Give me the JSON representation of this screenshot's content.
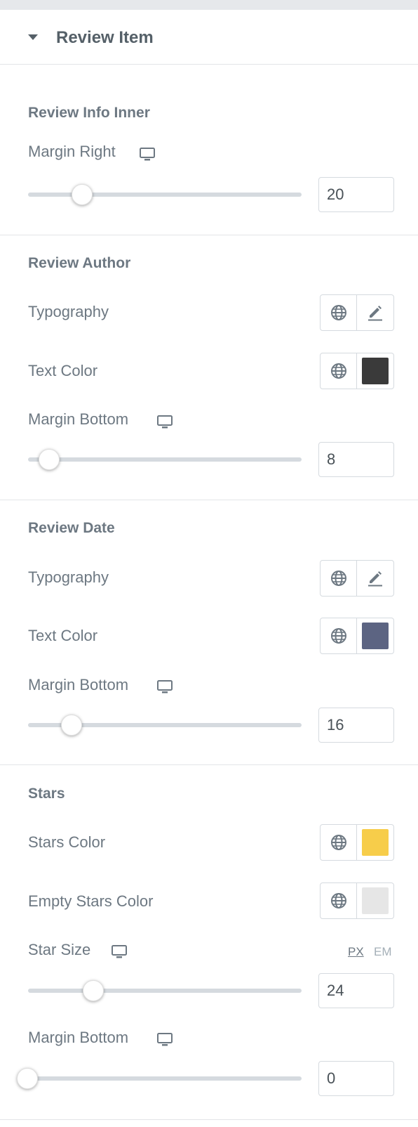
{
  "panel": {
    "title": "Review Item"
  },
  "review_info_inner": {
    "title": "Review Info Inner",
    "margin_right": {
      "label": "Margin Right",
      "value": "20",
      "fraction": 0.2
    }
  },
  "review_author": {
    "title": "Review Author",
    "typography_label": "Typography",
    "text_color": {
      "label": "Text Color",
      "color": "#3a3a3a"
    },
    "margin_bottom": {
      "label": "Margin Bottom",
      "value": "8",
      "fraction": 0.08
    }
  },
  "review_date": {
    "title": "Review Date",
    "typography_label": "Typography",
    "text_color": {
      "label": "Text Color",
      "color": "#5c6482"
    },
    "margin_bottom": {
      "label": "Margin Bottom",
      "value": "16",
      "fraction": 0.16
    }
  },
  "stars": {
    "title": "Stars",
    "stars_color": {
      "label": "Stars Color",
      "color": "#f7cd4a"
    },
    "empty_stars_color": {
      "label": "Empty Stars Color",
      "color": "#e6e6e6"
    },
    "star_size": {
      "label": "Star Size",
      "value": "24",
      "fraction": 0.24,
      "units": [
        "PX",
        "EM"
      ],
      "selected_unit": "PX"
    },
    "margin_bottom": {
      "label": "Margin Bottom",
      "value": "0",
      "fraction": 0.0
    }
  },
  "icons": {
    "responsive": "monitor-icon",
    "global": "globe-icon",
    "edit": "pencil-icon",
    "collapse": "caret-down-icon"
  }
}
